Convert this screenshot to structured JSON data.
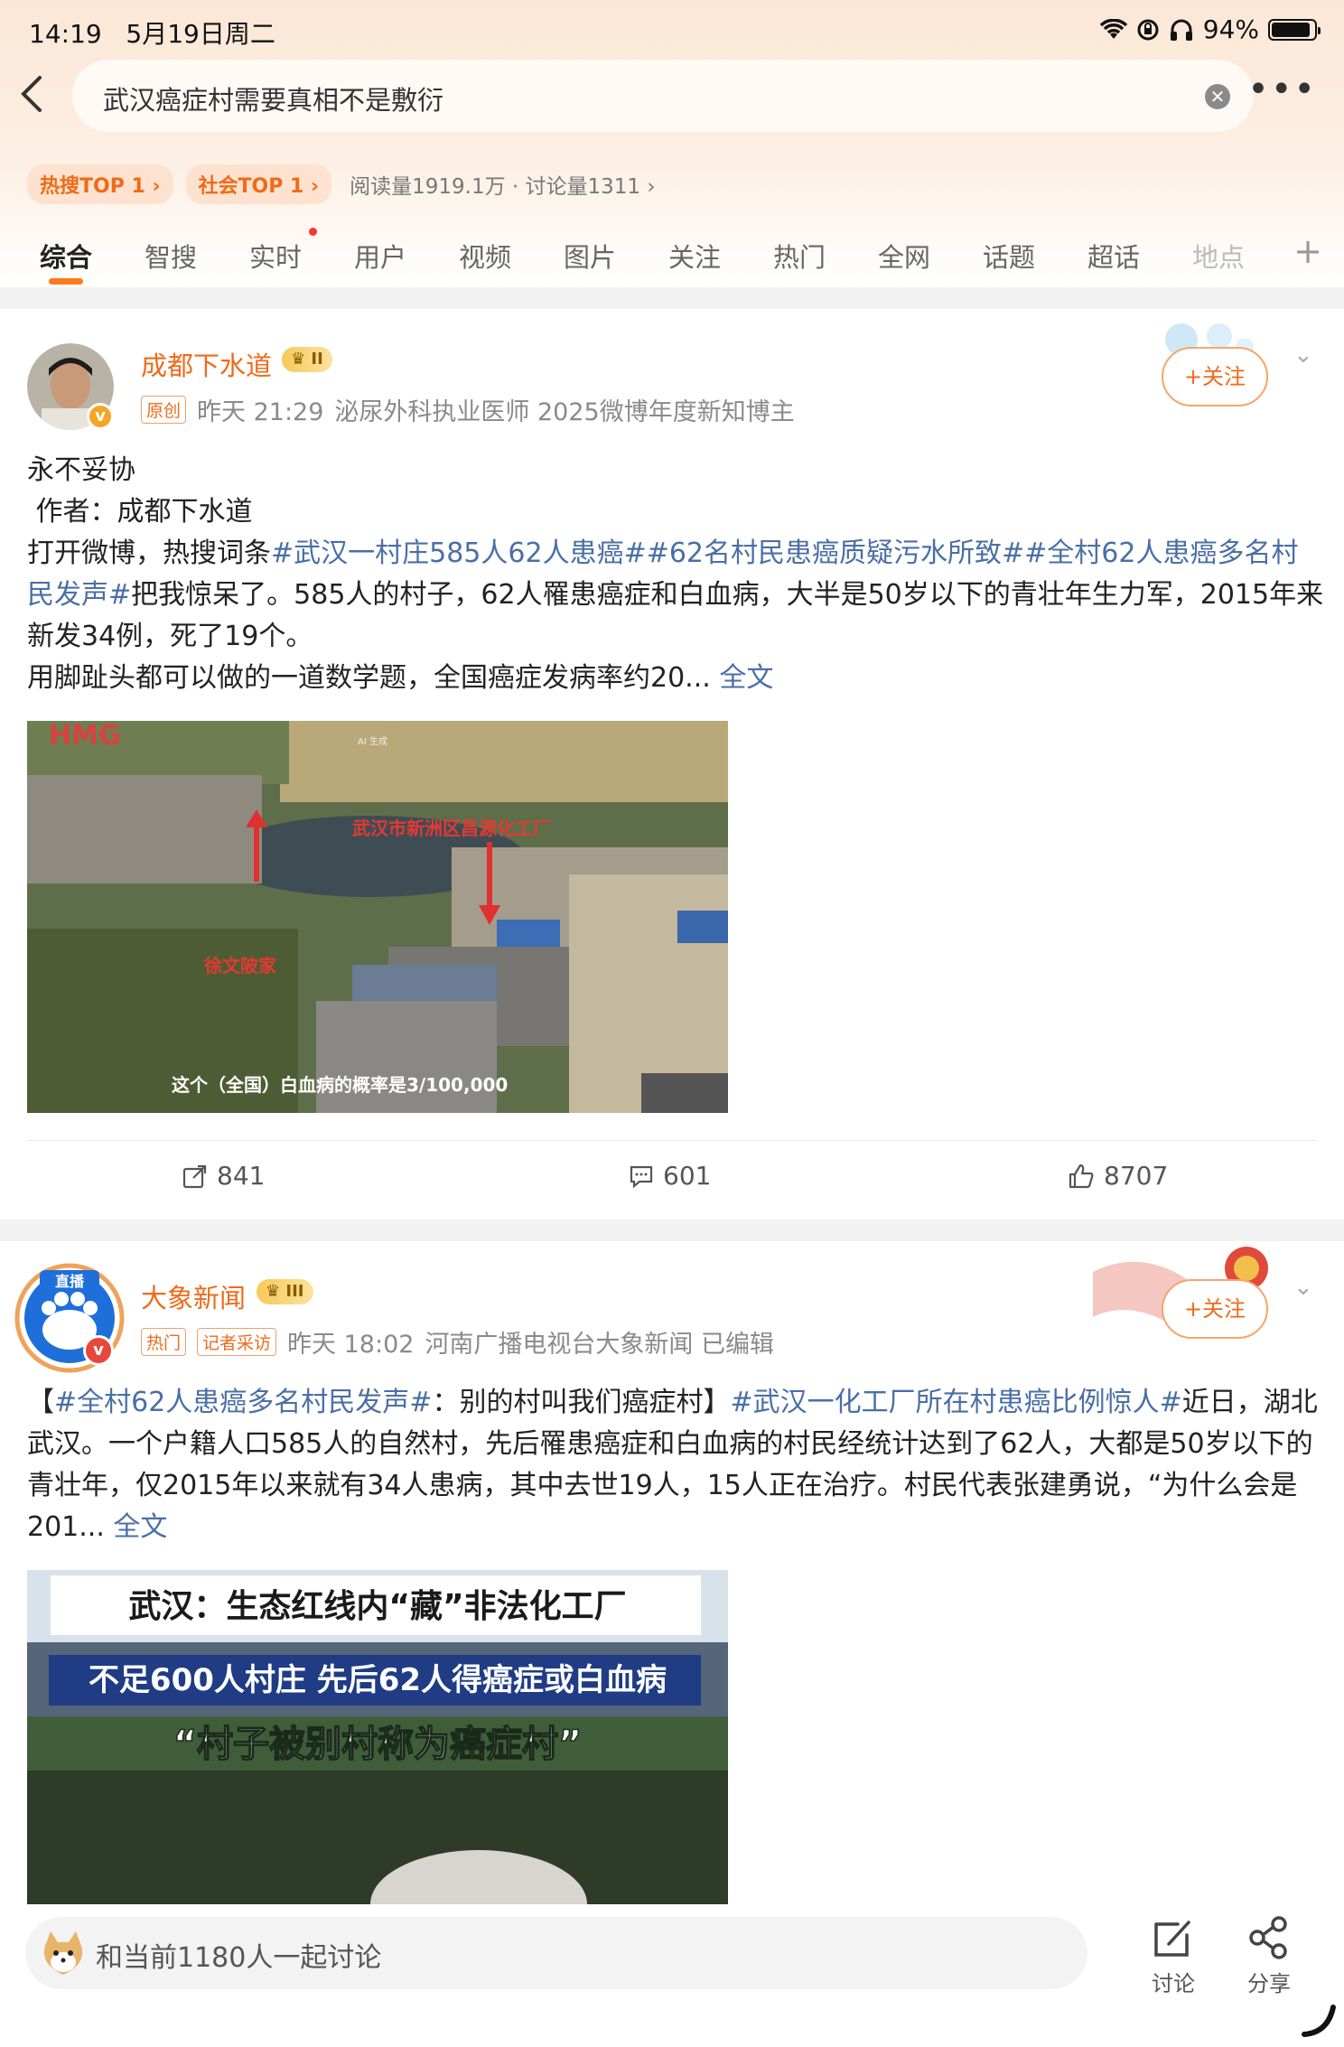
{
  "status": {
    "time": "14:19",
    "date": "5月19日周二",
    "battery": "94%",
    "battery_level": 0.94
  },
  "search": {
    "query": "武汉癌症村需要真相不是敷衍"
  },
  "chips": {
    "hot": "热搜TOP 1",
    "social": "社会TOP 1"
  },
  "stats": "阅读量1919.1万 · 讨论量1311",
  "tabs": [
    "综合",
    "智搜",
    "实时",
    "用户",
    "视频",
    "图片",
    "关注",
    "热门",
    "全网",
    "话题",
    "超话",
    "地点"
  ],
  "tabs_plus": "+",
  "post1": {
    "username": "成都下水道",
    "level": "II",
    "tag": "原创",
    "time": "昨天 21:29",
    "desc": "泌尿外科执业医师 2025微博年度新知博主",
    "follow": "+关注",
    "line1": "永不妥协",
    "line2": " 作者：成都下水道",
    "line3_pre": "打开微博，热搜词条",
    "line3_link": "#武汉一村庄585人62人患癌##62名村民患癌质疑污水所致##全村62人患癌多名村民发声#",
    "line3_post": "把我惊呆了。585人的村子，62人罹患癌症和白血病，大半是50岁以下的青壮年生力军，2015年来新发34例，死了19个。",
    "line4": "用脚趾头都可以做的一道数学题，全国癌症发病率约20... ",
    "fulltext": "全文",
    "img_logo": "HMG",
    "img_ai": "AI 生成",
    "img_label_top": "武汉市新洲区昌源化工厂",
    "img_label_left": "徐文陂家",
    "img_caption": "这个（全国）白血病的概率是3/100,000",
    "repost": "841",
    "comments": "601",
    "likes": "8707"
  },
  "post2": {
    "username": "大象新闻",
    "level": "III",
    "live": "直播",
    "tag1": "热门",
    "tag2": "记者采访",
    "time": "昨天 18:02",
    "desc": "河南广播电视台大象新闻 已编辑",
    "follow": "+关注",
    "p_a": "【",
    "p_link1": "#全村62人患癌多名村民发声#",
    "p_b": "：别的村叫我们癌症村】",
    "p_link2": "#武汉一化工厂所在村患癌比例惊人#",
    "p_c": "近日，湖北武汉。一个户籍人口585人的自然村，先后罹患癌症和白血病的村民经统计达到了62人，大都是50岁以下的青壮年，仅2015年以来就有34人患病，其中去世19人，15人正在治疗。村民代表张建勇说，“为什么会是201... ",
    "fulltext": "全文",
    "img_title1": "武汉：生态红线内“藏”非法化工厂",
    "img_title2": "不足600人村庄 先后62人得癌症或白血病",
    "img_title3": "“村子被别村称为癌症村”"
  },
  "bottom": {
    "placeholder": "和当前1180人一起讨论",
    "discuss": "讨论",
    "share": "分享"
  }
}
